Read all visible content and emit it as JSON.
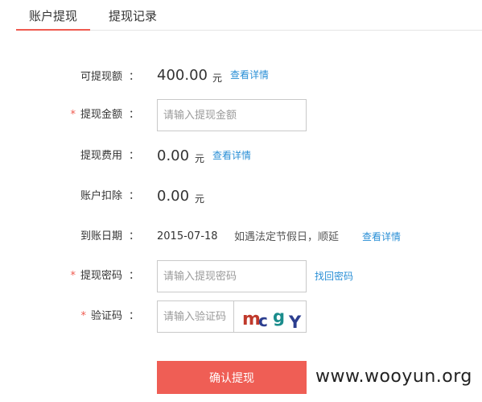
{
  "tabs": [
    {
      "label": "账户提现",
      "active": true
    },
    {
      "label": "提现记录",
      "active": false
    }
  ],
  "form": {
    "available": {
      "label": "可提现额",
      "colon": "：",
      "value": "400.00",
      "unit": "元",
      "link": "查看详情"
    },
    "amount": {
      "required_mark": "*",
      "label": "提现金额",
      "colon": "：",
      "placeholder": "请输入提现金额"
    },
    "fee": {
      "label": "提现费用",
      "colon": "：",
      "value": "0.00",
      "unit": "元",
      "link": "查看详情"
    },
    "deduction": {
      "label": "账户扣除",
      "colon": "：",
      "value": "0.00",
      "unit": "元"
    },
    "arrival_date": {
      "label": "到账日期",
      "colon": "：",
      "value": "2015-07-18",
      "note": "如遇法定节假日，顺延",
      "link": "查看详情"
    },
    "password": {
      "required_mark": "*",
      "label": "提现密码",
      "colon": "：",
      "placeholder": "请输入提现密码",
      "link": "找回密码"
    },
    "captcha": {
      "required_mark": "*",
      "label": "验证码",
      "colon": "：",
      "placeholder": "请输入验证码",
      "code": [
        "m",
        "c",
        "g",
        "Y"
      ],
      "code_colors": [
        "#c0392b",
        "#2c3e8f",
        "#1a8c8c",
        "#2c3e8f"
      ]
    },
    "submit_label": "确认提现"
  },
  "watermark": "www.wooyun.org",
  "colors": {
    "accent": "#ef5e55",
    "link": "#2a8fd6",
    "required": "#ef5a4f"
  }
}
